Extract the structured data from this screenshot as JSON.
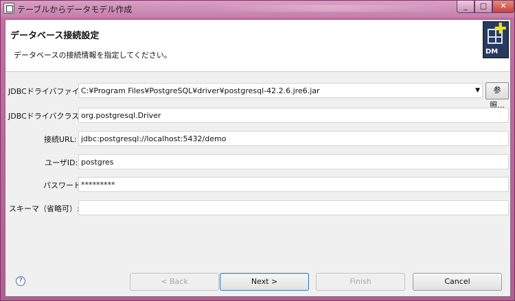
{
  "window": {
    "title": "テーブルからデータモデル作成",
    "min_label": "_",
    "max_label": "□",
    "close_label": "✕"
  },
  "header": {
    "title": "データベース接続設定",
    "description": "データベースの接続情報を指定してください。",
    "icon_label": "DM"
  },
  "form": {
    "jdbc_driver_file": {
      "label": "JDBCドライバファイル:",
      "value": "C:¥Program Files¥PostgreSQL¥driver¥postgresql-42.2.6.jre6.jar",
      "browse_label": "参照..."
    },
    "jdbc_driver_class": {
      "label": "JDBCドライバクラス名:",
      "value": "org.postgresql.Driver"
    },
    "connection_url": {
      "label": "接続URL:",
      "value": "jdbc:postgresql://localhost:5432/demo"
    },
    "user_id": {
      "label": "ユーザID:",
      "value": "postgres"
    },
    "password": {
      "label": "パスワード:",
      "value": "*********"
    },
    "schema": {
      "label": "スキーマ（省略可）:",
      "value": ""
    }
  },
  "footer": {
    "help_symbol": "?",
    "back_label": "< Back",
    "next_label": "Next >",
    "finish_label": "Finish",
    "cancel_label": "Cancel"
  }
}
